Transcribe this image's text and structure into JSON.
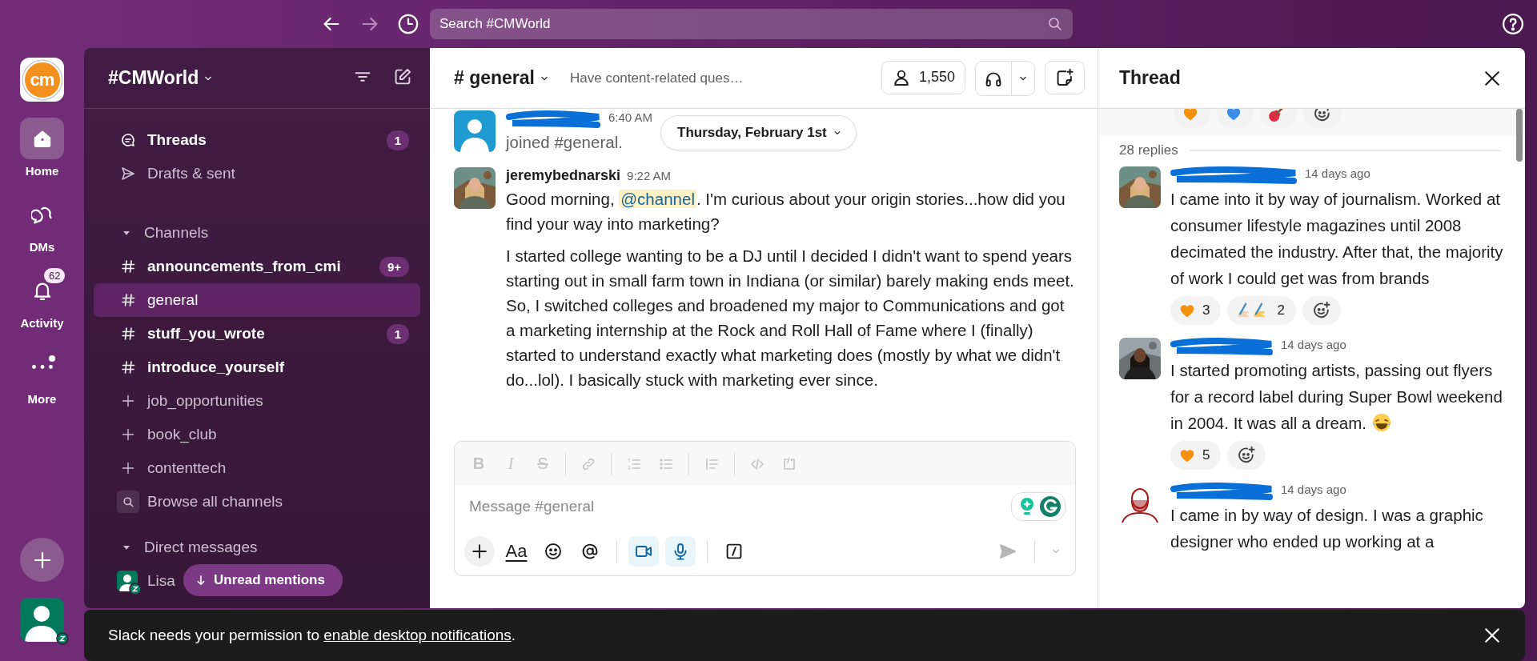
{
  "top_bar": {
    "search": {
      "placeholder": "Search #CMWorld"
    }
  },
  "workspace": {
    "logo_text": "cm",
    "name": "#CMWorld"
  },
  "rail": [
    {
      "kind": "home",
      "label": "Home",
      "selected": true
    },
    {
      "kind": "dms",
      "label": "DMs",
      "selected": false
    },
    {
      "kind": "activity",
      "label": "Activity",
      "selected": false,
      "badge": "62"
    },
    {
      "kind": "more",
      "label": "More",
      "selected": false,
      "dot": true
    }
  ],
  "sidebar": {
    "items": [
      {
        "kind": "threads",
        "label": "Threads",
        "unread": true,
        "selected": false,
        "badge": "1"
      },
      {
        "kind": "drafts",
        "label": "Drafts & sent",
        "unread": false,
        "selected": false
      },
      {
        "kind": "section",
        "label": "Channels",
        "expanded": true
      },
      {
        "kind": "channel",
        "label": "announcements_from_cmi",
        "unread": true,
        "selected": false,
        "badge": "9+"
      },
      {
        "kind": "channel",
        "label": "general",
        "unread": false,
        "selected": true
      },
      {
        "kind": "channel",
        "label": "stuff_you_wrote",
        "unread": true,
        "selected": false,
        "badge": "1"
      },
      {
        "kind": "channel",
        "label": "introduce_yourself",
        "unread": true,
        "selected": false
      },
      {
        "kind": "suggested",
        "label": "job_opportunities",
        "unread": false,
        "selected": false
      },
      {
        "kind": "suggested",
        "label": "book_club",
        "unread": false,
        "selected": false
      },
      {
        "kind": "suggested",
        "label": "contenttech",
        "unread": false,
        "selected": false
      },
      {
        "kind": "browse",
        "label": "Browse all channels",
        "unread": false,
        "selected": false
      },
      {
        "kind": "section",
        "label": "Direct messages",
        "expanded": true
      },
      {
        "kind": "dm",
        "label": "Lisa",
        "unread": false,
        "selected": false
      }
    ],
    "unread_mentions": "Unread mentions"
  },
  "channel_header": {
    "title": "# general",
    "topic": "Have content-related ques…",
    "members": "1,550"
  },
  "date_divider": "Thursday, February 1st",
  "messages": [
    {
      "avatar": {
        "kind": "silhouette"
      },
      "time": "6:40 AM",
      "paragraphs": [
        [
          {
            "text": "joined #general."
          }
        ]
      ]
    },
    {
      "avatar": {
        "kind": "picture"
      },
      "author": "jeremybednarski",
      "time": "9:22 AM",
      "paragraphs": [
        [
          {
            "text": "Good morning, "
          },
          {
            "kind": "mention",
            "text": "@channel"
          },
          {
            "text": ". I'm curious about your origin stories...how did you find your way into marketing?"
          }
        ],
        [
          {
            "text": "I started college wanting to be a DJ until I decided I didn't want to spend years starting out in small farm town in Indiana (or similar) barely making ends meet. So, I switched colleges and broadened my major to Communications and got a marketing internship at the Rock and Roll Hall of Fame where I (finally) started to understand exactly what marketing does (mostly by what we didn't do...lol). I basically stuck with marketing ever since."
          }
        ]
      ]
    }
  ],
  "composer": {
    "toolbar": [
      {
        "kind": "bold",
        "label": "B",
        "disabled": true
      },
      {
        "kind": "italic",
        "label": "I",
        "disabled": true
      },
      {
        "kind": "strike",
        "label": "S",
        "disabled": true
      },
      {
        "kind": "link",
        "disabled": true
      },
      {
        "kind": "ordered-list",
        "disabled": true
      },
      {
        "kind": "bullet-list",
        "disabled": true
      },
      {
        "kind": "quote",
        "disabled": true
      },
      {
        "kind": "code",
        "disabled": true
      },
      {
        "kind": "code-block",
        "disabled": true
      }
    ],
    "placeholder": "Message #general",
    "format_label": "Aa",
    "actions": [
      {
        "kind": "video",
        "active": true
      },
      {
        "kind": "mic",
        "active": true
      }
    ]
  },
  "thread": {
    "title": "Thread",
    "parent_reactions": [
      {
        "kind": "orange-heart"
      },
      {
        "kind": "blue-heart"
      },
      {
        "kind": "guitar"
      },
      {
        "kind": "add"
      }
    ],
    "replies_count": "28 replies",
    "replies": [
      {
        "avatar": {
          "kind": "picture"
        },
        "time": "14 days ago",
        "text": "I came into it by way of journalism. Worked at consumer lifestyle magazines until 2008 decimated the industry. After that, the majority of work I could get was from brands",
        "reactions": [
          {
            "kind": "orange-heart",
            "count": "3"
          },
          {
            "kind": "writing-hands",
            "count": "2"
          },
          {
            "kind": "add"
          }
        ]
      },
      {
        "avatar": {
          "kind": "picture"
        },
        "time": "14 days ago",
        "text": "I started promoting artists, passing out flyers for a record label during Super Bowl weekend in 2004. It was all a dream.",
        "emoji": {
          "kind": "laughing"
        },
        "reactions": [
          {
            "kind": "orange-heart",
            "count": "5"
          },
          {
            "kind": "add"
          }
        ]
      },
      {
        "avatar": {
          "kind": "sketch"
        },
        "time": "14 days ago",
        "text": "I came in by way of design. I was a graphic designer who ended up working at a"
      }
    ]
  },
  "banner": {
    "parts": [
      {
        "text": "Slack needs your permission to "
      },
      {
        "kind": "link",
        "text": "enable desktop notifications"
      },
      {
        "text": "."
      }
    ]
  }
}
